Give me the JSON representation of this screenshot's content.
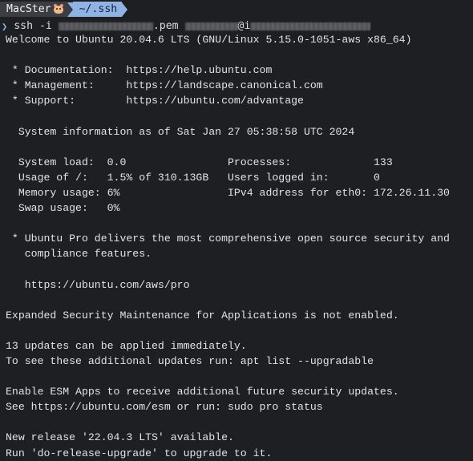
{
  "prompt": {
    "host": "MacSter",
    "host_icon": "hamster-icon",
    "cwd": "~/.ssh"
  },
  "command": {
    "part1": "ssh -i ",
    "key_suffix": ".pem ",
    "at": "@i"
  },
  "colors": {
    "background": "#1e1f22",
    "host_segment": "#3b3d42",
    "dir_segment": "#8fb3e4",
    "text": "#e3e3e3"
  },
  "output_lines": [
    "Welcome to Ubuntu 20.04.6 LTS (GNU/Linux 5.15.0-1051-aws x86_64)",
    "",
    " * Documentation:  https://help.ubuntu.com",
    " * Management:     https://landscape.canonical.com",
    " * Support:        https://ubuntu.com/advantage",
    "",
    "  System information as of Sat Jan 27 05:38:58 UTC 2024",
    "",
    "  System load:  0.0                Processes:             133",
    "  Usage of /:   1.5% of 310.13GB   Users logged in:       0",
    "  Memory usage: 6%                 IPv4 address for eth0: 172.26.11.30",
    "  Swap usage:   0%",
    "",
    " * Ubuntu Pro delivers the most comprehensive open source security and",
    "   compliance features.",
    "",
    "   https://ubuntu.com/aws/pro",
    "",
    "Expanded Security Maintenance for Applications is not enabled.",
    "",
    "13 updates can be applied immediately.",
    "To see these additional updates run: apt list --upgradable",
    "",
    "Enable ESM Apps to receive additional future security updates.",
    "See https://ubuntu.com/esm or run: sudo pro status",
    "",
    "New release '22.04.3 LTS' available.",
    "Run 'do-release-upgrade' to upgrade to it."
  ]
}
